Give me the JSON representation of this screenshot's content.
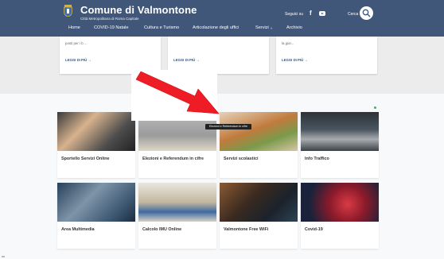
{
  "header": {
    "title": "Comune di Valmontone",
    "subtitle": "Città Metropolitana di Roma Capitale",
    "follow_label": "Seguici su",
    "search_label": "Cerca",
    "icons": [
      "crest-icon",
      "facebook-icon",
      "youtube-icon",
      "search-icon"
    ]
  },
  "nav": {
    "items": [
      {
        "label": "Home"
      },
      {
        "label": "COVID-19 Natale"
      },
      {
        "label": "Cultura e Turismo"
      },
      {
        "label": "Articolazione degli uffici"
      },
      {
        "label": "Servizi"
      },
      {
        "label": "Archivio"
      }
    ],
    "servizi_chevron": "˅"
  },
  "news": [
    {
      "text": "posti per i b ...",
      "link": "LEGGI DI PIÙ →"
    },
    {
      "text": "",
      "link": "LEGGI DI PIÙ →"
    },
    {
      "text": "la gior...",
      "link": "LEGGI DI PIÙ →"
    }
  ],
  "services": [
    {
      "label": "Sportello Servizi Online",
      "image": "laptop-hands"
    },
    {
      "label": "Elezioni e Referendum in cifre",
      "image": "ballot-box"
    },
    {
      "label": "Servizi scolastici",
      "image": "school-meals"
    },
    {
      "label": "Info Traffico",
      "image": "traffic-jam"
    },
    {
      "label": "Area Multimedia",
      "image": "video-call"
    },
    {
      "label": "Calcolo IMU Online",
      "image": "house-model"
    },
    {
      "label": "Valmontone Free WiFi",
      "image": "smartphone"
    },
    {
      "label": "Covid-19",
      "image": "coronavirus"
    }
  ],
  "tooltip": "Elezioni e Referendum in cifre",
  "annotation": {
    "color": "#ee1c24"
  },
  "colors": {
    "header": "#41577a",
    "upper_bg": "#ececed",
    "lower_bg": "#f7f9fb",
    "link": "#41577a"
  }
}
